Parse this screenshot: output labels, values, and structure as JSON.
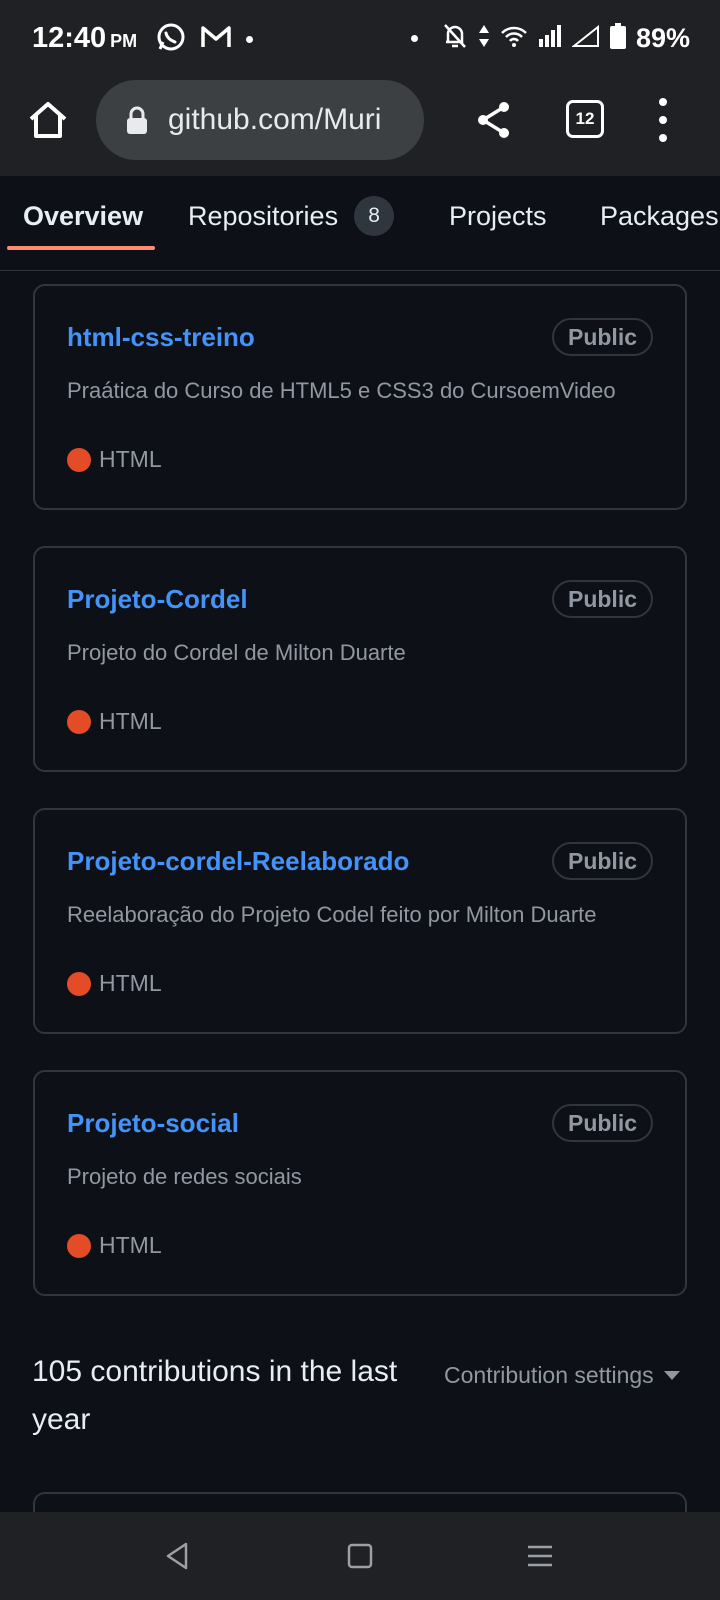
{
  "status_bar": {
    "time": "12:40",
    "ampm": "PM",
    "battery": "89%",
    "icons": [
      "whatsapp-icon",
      "gmail-icon",
      "dot-icon",
      "dot-icon",
      "mute-icon",
      "data-arrows-icon",
      "wifi-icon",
      "signal-icon",
      "signal-outline-icon",
      "battery-icon"
    ]
  },
  "browser": {
    "url": "github.com/Muri",
    "tab_count": "12"
  },
  "nav": {
    "tabs": [
      {
        "label": "Overview",
        "active": true
      },
      {
        "label": "Repositories",
        "count": "8"
      },
      {
        "label": "Projects"
      },
      {
        "label": "Packages"
      }
    ]
  },
  "repos": [
    {
      "name": "html-css-treino",
      "visibility": "Public",
      "description": "Praática do Curso de HTML5 e CSS3 do CursoemVideo",
      "language": "HTML",
      "language_color": "#e34c26"
    },
    {
      "name": "Projeto-Cordel",
      "visibility": "Public",
      "description": "Projeto do Cordel de Milton Duarte",
      "language": "HTML",
      "language_color": "#e34c26"
    },
    {
      "name": "Projeto-cordel-Reelaborado",
      "visibility": "Public",
      "description": "Reelaboração do Projeto Codel feito por Milton Duarte",
      "language": "HTML",
      "language_color": "#e34c26"
    },
    {
      "name": "Projeto-social",
      "visibility": "Public",
      "description": "Projeto de redes sociais",
      "language": "HTML",
      "language_color": "#e34c26"
    }
  ],
  "contributions": {
    "heading": "105 contributions in the last year",
    "settings_label": "Contribution settings"
  },
  "colors": {
    "background": "#0d1117",
    "link": "#4493f8",
    "active_underline": "#fd8c73",
    "muted_text": "#9198a1"
  }
}
